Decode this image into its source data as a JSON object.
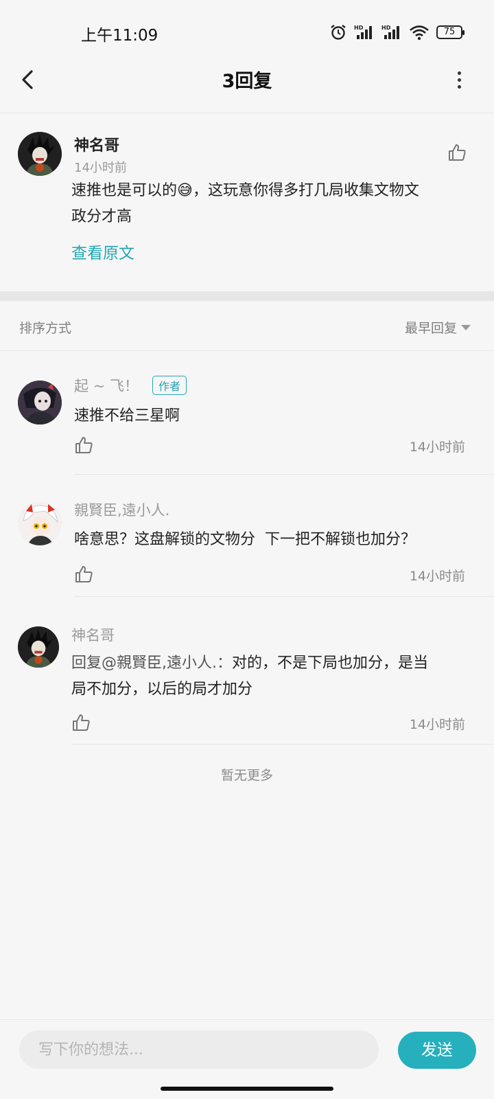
{
  "status_bar": {
    "time": "上午11:09",
    "battery": "75"
  },
  "header": {
    "title": "3回复"
  },
  "main_comment": {
    "author": "神名哥",
    "time": "14小时前",
    "text_before_emoji": "速推也是可以的",
    "emoji": "😅",
    "text_line1_rest": "，这玩意你得多打几局收集文物文",
    "text_line2": "政分才高",
    "view_original": "查看原文"
  },
  "sort": {
    "label": "排序方式",
    "value": "最早回复"
  },
  "replies": [
    {
      "name": "起 ~ 飞！",
      "badge": "作者",
      "text": "速推不给三星啊",
      "time": "14小时前"
    },
    {
      "name": "親賢臣,遠小人.",
      "text": "啥意思？这盘解锁的文物分  下一把不解锁也加分？",
      "time": "14小时前"
    },
    {
      "name": "神名哥",
      "reply_to": "回复@親賢臣,遠小人.：",
      "text_line1": "对的，不是下局也加分，是当",
      "text_line2": "局不加分，以后的局才加分",
      "time": "14小时前"
    }
  ],
  "no_more": "暂无更多",
  "composer": {
    "placeholder": "写下你的想法...",
    "send_label": "发送"
  },
  "colors": {
    "accent": "#26b0bd",
    "link": "#26a6b4"
  }
}
